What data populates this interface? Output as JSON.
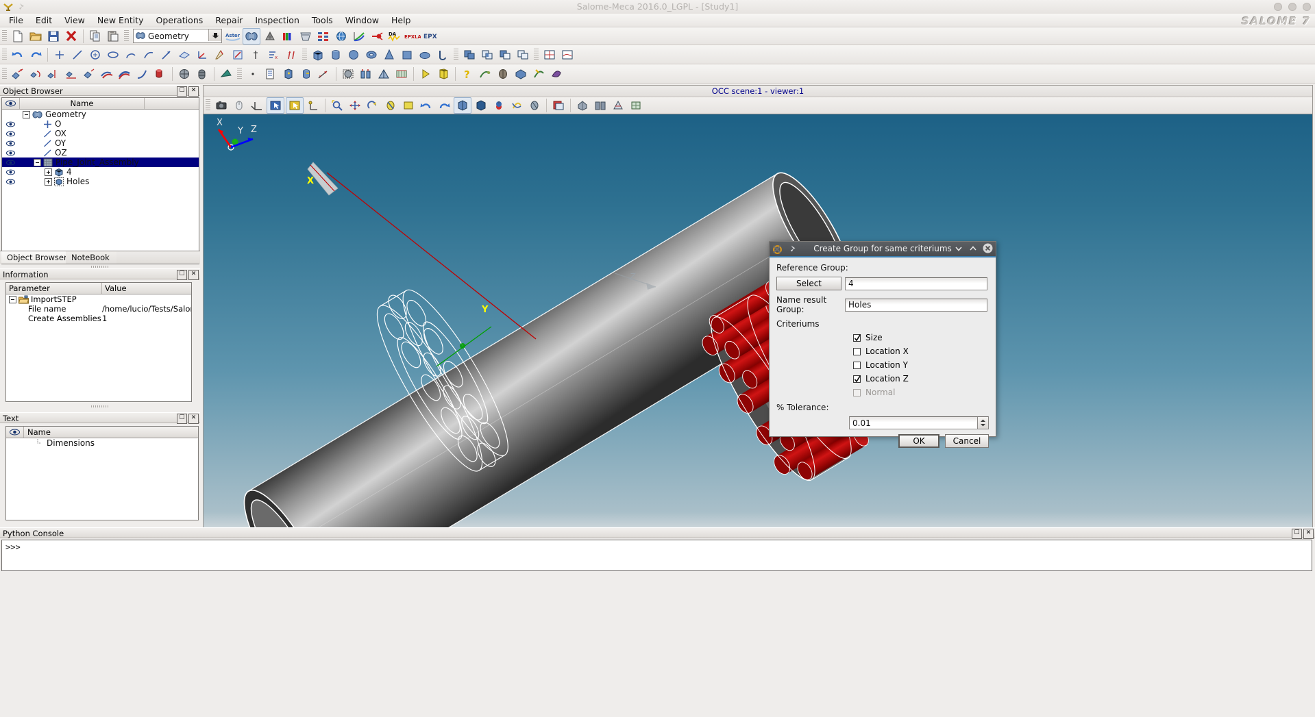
{
  "window": {
    "title": "Salome-Meca 2016.0_LGPL - [Study1]",
    "logo": "SALOME 7"
  },
  "menubar": {
    "items": [
      "File",
      "Edit",
      "View",
      "New Entity",
      "Operations",
      "Repair",
      "Inspection",
      "Tools",
      "Window",
      "Help"
    ]
  },
  "toolbar_main": {
    "module_combo_value": "Geometry",
    "aster_label": "Aster",
    "epx_label": "EPX",
    "epxlab_label": "EPX LAB"
  },
  "object_browser": {
    "caption": "Object Browser",
    "columns": [
      "",
      "Name"
    ],
    "nodes": [
      {
        "label": "Geometry",
        "depth": 0,
        "icon": "geometry-icon",
        "expander": "minus",
        "eye": false,
        "selected": false
      },
      {
        "label": "O",
        "depth": 1,
        "icon": "point-icon",
        "expander": "none",
        "eye": true,
        "selected": false
      },
      {
        "label": "OX",
        "depth": 1,
        "icon": "line-icon",
        "expander": "none",
        "eye": true,
        "selected": false
      },
      {
        "label": "OY",
        "depth": 1,
        "icon": "line-icon",
        "expander": "none",
        "eye": true,
        "selected": false
      },
      {
        "label": "OZ",
        "depth": 1,
        "icon": "line-icon",
        "expander": "none",
        "eye": true,
        "selected": false
      },
      {
        "label": "Pipe_Joint_Assembly",
        "depth": 1,
        "icon": "compound-icon",
        "expander": "minus",
        "eye": true,
        "selected": true
      },
      {
        "label": "4",
        "depth": 2,
        "icon": "solid-icon",
        "expander": "plus",
        "eye": true,
        "selected": false
      },
      {
        "label": "Holes",
        "depth": 2,
        "icon": "group-icon",
        "expander": "plus",
        "eye": true,
        "selected": false
      }
    ],
    "tabs": [
      {
        "label": "Object Browser",
        "active": true
      },
      {
        "label": "NoteBook",
        "active": false
      }
    ]
  },
  "information": {
    "caption": "Information",
    "columns": [
      "Parameter",
      "Value"
    ],
    "rows": [
      {
        "param": "ImportSTEP",
        "value": "",
        "depth": 0,
        "icon": "import-icon",
        "expander": "minus"
      },
      {
        "param": "File name",
        "value": "/home/lucio/Tests/Salome...",
        "depth": 1,
        "icon": "",
        "expander": "none"
      },
      {
        "param": "Create Assemblies",
        "value": "1",
        "depth": 1,
        "icon": "",
        "expander": "none"
      }
    ]
  },
  "text_panel": {
    "caption": "Text",
    "columns": [
      "",
      "Name"
    ],
    "rows": [
      {
        "label": "Dimensions",
        "depth": 1
      }
    ]
  },
  "viewer": {
    "title": "OCC scene:1 - viewer:1",
    "axis_labels": {
      "x": "X",
      "y": "Y",
      "z": "Z"
    },
    "trihedron": {
      "x": "X",
      "y": "Y",
      "z": "Z"
    },
    "colors": {
      "background_top": "#1d6186",
      "background_bottom": "#cdd6da",
      "selection_red": "#b00000",
      "wireframe": "#ffffff",
      "x_axis": "#ff0000",
      "y_axis": "#00b000",
      "z_axis": "#0000ff"
    }
  },
  "python_console": {
    "caption": "Python Console",
    "prompt": ">>>"
  },
  "dialog": {
    "title": "Create Group for same criteriums",
    "reference_group_label": "Reference Group:",
    "select_button": "Select",
    "reference_group_value": "4",
    "name_result_label": "Name result Group:",
    "name_result_value": "Holes",
    "criteriums_label": "Criteriums",
    "criteriums": [
      {
        "label": "Size",
        "checked": true,
        "enabled": true
      },
      {
        "label": "Location X",
        "checked": false,
        "enabled": true
      },
      {
        "label": "Location Y",
        "checked": false,
        "enabled": true
      },
      {
        "label": "Location Z",
        "checked": true,
        "enabled": true
      },
      {
        "label": "Normal",
        "checked": false,
        "enabled": false
      }
    ],
    "tolerance_label": "% Tolerance:",
    "tolerance_value": "0.01",
    "ok_button": "OK",
    "cancel_button": "Cancel",
    "accent_color": "#3c7fb1"
  }
}
